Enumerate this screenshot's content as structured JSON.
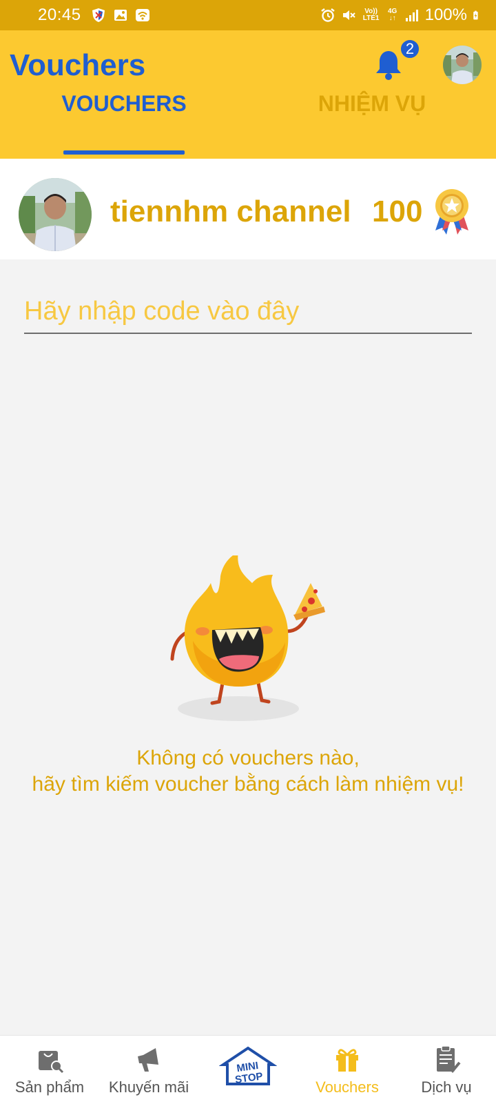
{
  "status_bar": {
    "time": "20:45",
    "network_line1": "Vo))",
    "network_line2": "LTE1",
    "network_type": "4G",
    "battery": "100%"
  },
  "header": {
    "title": "Vouchers",
    "notification_count": "2",
    "tabs": [
      {
        "label": "VOUCHERS",
        "active": true
      },
      {
        "label": "NHIỆM VỤ",
        "active": false
      }
    ]
  },
  "profile": {
    "name": "tiennhm channel",
    "points": "100"
  },
  "code_input": {
    "placeholder": "Hãy nhập code vào đây",
    "value": ""
  },
  "empty_state": {
    "line1": "Không có vouchers nào,",
    "line2": "hãy tìm kiếm voucher bằng cách làm nhiệm vụ!"
  },
  "bottom_nav": {
    "items": [
      {
        "label": "Sản phẩm",
        "icon": "shopping-bag-icon"
      },
      {
        "label": "Khuyến mãi",
        "icon": "megaphone-icon"
      },
      {
        "label": "",
        "icon": "ministop-home-icon",
        "logo_text_1": "MINI",
        "logo_text_2": "STOP"
      },
      {
        "label": "Vouchers",
        "icon": "gift-icon",
        "active": true
      },
      {
        "label": "Dịch vụ",
        "icon": "clipboard-check-icon"
      }
    ]
  },
  "colors": {
    "header_bg": "#fcc930",
    "status_bg": "#dca508",
    "brand_blue": "#1f5ed1",
    "accent_gold": "#dca508"
  }
}
